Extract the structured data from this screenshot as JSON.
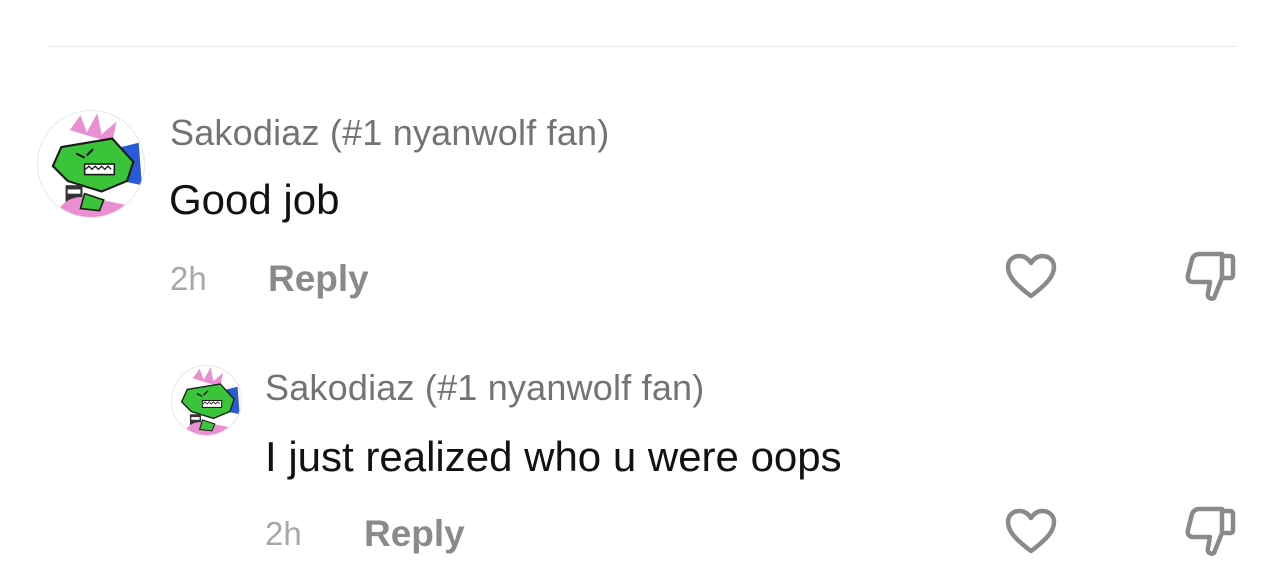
{
  "comments": [
    {
      "username": "Sakodiaz (#1 nyanwolf fan)",
      "text": "Good job",
      "time": "2h",
      "reply_label": "Reply"
    },
    {
      "username": "Sakodiaz (#1 nyanwolf fan)",
      "text": "I just realized who u were oops",
      "time": "2h",
      "reply_label": "Reply"
    }
  ],
  "icons": {
    "like": "heart-outline-icon",
    "dislike": "thumbs-down-outline-icon"
  },
  "colors": {
    "username": "#737373",
    "comment_text": "#111111",
    "meta": "#a8a8a8",
    "reply": "#8a8a8a",
    "icon": "#8a8a8a"
  }
}
